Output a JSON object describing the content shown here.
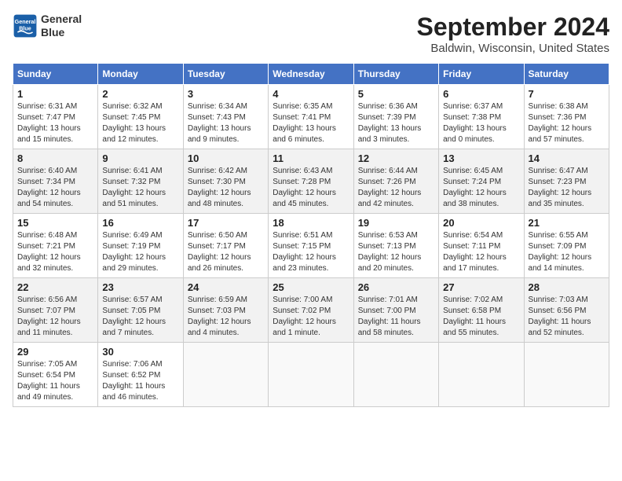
{
  "header": {
    "logo_line1": "General",
    "logo_line2": "Blue",
    "month": "September 2024",
    "location": "Baldwin, Wisconsin, United States"
  },
  "days_of_week": [
    "Sunday",
    "Monday",
    "Tuesday",
    "Wednesday",
    "Thursday",
    "Friday",
    "Saturday"
  ],
  "weeks": [
    [
      {
        "day": "1",
        "info": "Sunrise: 6:31 AM\nSunset: 7:47 PM\nDaylight: 13 hours\nand 15 minutes."
      },
      {
        "day": "2",
        "info": "Sunrise: 6:32 AM\nSunset: 7:45 PM\nDaylight: 13 hours\nand 12 minutes."
      },
      {
        "day": "3",
        "info": "Sunrise: 6:34 AM\nSunset: 7:43 PM\nDaylight: 13 hours\nand 9 minutes."
      },
      {
        "day": "4",
        "info": "Sunrise: 6:35 AM\nSunset: 7:41 PM\nDaylight: 13 hours\nand 6 minutes."
      },
      {
        "day": "5",
        "info": "Sunrise: 6:36 AM\nSunset: 7:39 PM\nDaylight: 13 hours\nand 3 minutes."
      },
      {
        "day": "6",
        "info": "Sunrise: 6:37 AM\nSunset: 7:38 PM\nDaylight: 13 hours\nand 0 minutes."
      },
      {
        "day": "7",
        "info": "Sunrise: 6:38 AM\nSunset: 7:36 PM\nDaylight: 12 hours\nand 57 minutes."
      }
    ],
    [
      {
        "day": "8",
        "info": "Sunrise: 6:40 AM\nSunset: 7:34 PM\nDaylight: 12 hours\nand 54 minutes."
      },
      {
        "day": "9",
        "info": "Sunrise: 6:41 AM\nSunset: 7:32 PM\nDaylight: 12 hours\nand 51 minutes."
      },
      {
        "day": "10",
        "info": "Sunrise: 6:42 AM\nSunset: 7:30 PM\nDaylight: 12 hours\nand 48 minutes."
      },
      {
        "day": "11",
        "info": "Sunrise: 6:43 AM\nSunset: 7:28 PM\nDaylight: 12 hours\nand 45 minutes."
      },
      {
        "day": "12",
        "info": "Sunrise: 6:44 AM\nSunset: 7:26 PM\nDaylight: 12 hours\nand 42 minutes."
      },
      {
        "day": "13",
        "info": "Sunrise: 6:45 AM\nSunset: 7:24 PM\nDaylight: 12 hours\nand 38 minutes."
      },
      {
        "day": "14",
        "info": "Sunrise: 6:47 AM\nSunset: 7:23 PM\nDaylight: 12 hours\nand 35 minutes."
      }
    ],
    [
      {
        "day": "15",
        "info": "Sunrise: 6:48 AM\nSunset: 7:21 PM\nDaylight: 12 hours\nand 32 minutes."
      },
      {
        "day": "16",
        "info": "Sunrise: 6:49 AM\nSunset: 7:19 PM\nDaylight: 12 hours\nand 29 minutes."
      },
      {
        "day": "17",
        "info": "Sunrise: 6:50 AM\nSunset: 7:17 PM\nDaylight: 12 hours\nand 26 minutes."
      },
      {
        "day": "18",
        "info": "Sunrise: 6:51 AM\nSunset: 7:15 PM\nDaylight: 12 hours\nand 23 minutes."
      },
      {
        "day": "19",
        "info": "Sunrise: 6:53 AM\nSunset: 7:13 PM\nDaylight: 12 hours\nand 20 minutes."
      },
      {
        "day": "20",
        "info": "Sunrise: 6:54 AM\nSunset: 7:11 PM\nDaylight: 12 hours\nand 17 minutes."
      },
      {
        "day": "21",
        "info": "Sunrise: 6:55 AM\nSunset: 7:09 PM\nDaylight: 12 hours\nand 14 minutes."
      }
    ],
    [
      {
        "day": "22",
        "info": "Sunrise: 6:56 AM\nSunset: 7:07 PM\nDaylight: 12 hours\nand 11 minutes."
      },
      {
        "day": "23",
        "info": "Sunrise: 6:57 AM\nSunset: 7:05 PM\nDaylight: 12 hours\nand 7 minutes."
      },
      {
        "day": "24",
        "info": "Sunrise: 6:59 AM\nSunset: 7:03 PM\nDaylight: 12 hours\nand 4 minutes."
      },
      {
        "day": "25",
        "info": "Sunrise: 7:00 AM\nSunset: 7:02 PM\nDaylight: 12 hours\nand 1 minute."
      },
      {
        "day": "26",
        "info": "Sunrise: 7:01 AM\nSunset: 7:00 PM\nDaylight: 11 hours\nand 58 minutes."
      },
      {
        "day": "27",
        "info": "Sunrise: 7:02 AM\nSunset: 6:58 PM\nDaylight: 11 hours\nand 55 minutes."
      },
      {
        "day": "28",
        "info": "Sunrise: 7:03 AM\nSunset: 6:56 PM\nDaylight: 11 hours\nand 52 minutes."
      }
    ],
    [
      {
        "day": "29",
        "info": "Sunrise: 7:05 AM\nSunset: 6:54 PM\nDaylight: 11 hours\nand 49 minutes."
      },
      {
        "day": "30",
        "info": "Sunrise: 7:06 AM\nSunset: 6:52 PM\nDaylight: 11 hours\nand 46 minutes."
      },
      {
        "day": "",
        "info": ""
      },
      {
        "day": "",
        "info": ""
      },
      {
        "day": "",
        "info": ""
      },
      {
        "day": "",
        "info": ""
      },
      {
        "day": "",
        "info": ""
      }
    ]
  ]
}
